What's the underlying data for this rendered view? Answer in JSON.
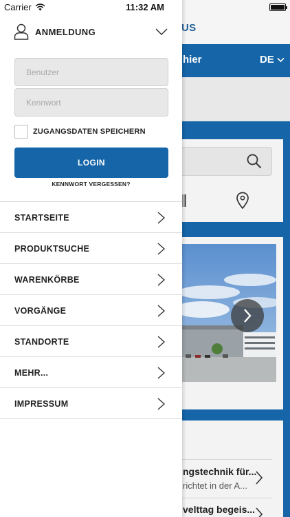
{
  "status_bar": {
    "carrier": "Carrier",
    "time": "11:32 AM",
    "battery_level": 1.0
  },
  "background_app": {
    "title_partial": "US",
    "bluebar_text_partial": "hier",
    "language": "DE",
    "news": [
      {
        "title_partial": "ngstechnik für...",
        "subtitle_partial": "richtet in der A..."
      },
      {
        "title_partial": "velttag begeis...",
        "subtitle_partial": ""
      }
    ],
    "colors": {
      "brand_blue": "#1565a8"
    }
  },
  "login": {
    "title": "ANMELDUNG",
    "username_placeholder": "Benutzer",
    "password_placeholder": "Kennwort",
    "remember_label": "ZUGANGSDATEN SPEICHERN",
    "remember_checked": false,
    "login_button": "LOGIN",
    "forgot_password": "KENNWORT VERGESSEN?"
  },
  "menu": {
    "items": [
      {
        "label": "STARTSEITE",
        "icon": "chevron-right-icon"
      },
      {
        "label": "PRODUKTSUCHE",
        "icon": "chevron-right-icon"
      },
      {
        "label": "WARENKÖRBE",
        "icon": "chevron-right-icon"
      },
      {
        "label": "VORGÄNGE",
        "icon": "chevron-right-icon"
      },
      {
        "label": "STANDORTE",
        "icon": "chevron-right-icon"
      },
      {
        "label": "MEHR...",
        "icon": "chevron-right-icon"
      },
      {
        "label": "IMPRESSUM",
        "icon": "chevron-right-icon"
      }
    ]
  }
}
